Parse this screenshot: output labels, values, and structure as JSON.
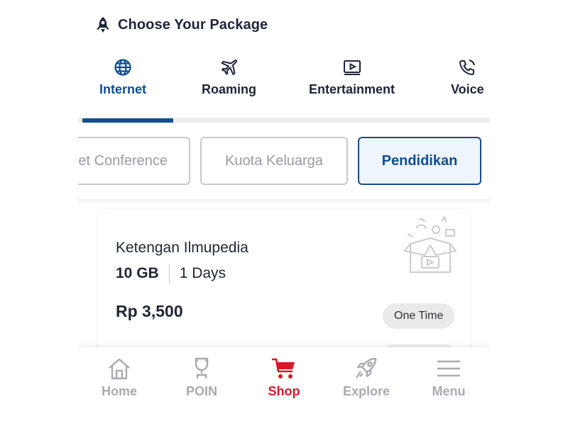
{
  "header": {
    "title": "Choose Your Package",
    "icon": "rocket-icon"
  },
  "tabs": [
    {
      "label": "Internet",
      "icon": "globe-icon",
      "active": true
    },
    {
      "label": "Roaming",
      "icon": "airplane-icon",
      "active": false
    },
    {
      "label": "Entertainment",
      "icon": "play-icon",
      "active": false
    },
    {
      "label": "Voice",
      "icon": "phone-icon",
      "active": false
    }
  ],
  "chips": [
    {
      "label": "Internet Conference",
      "active": false
    },
    {
      "label": "Kuota Keluarga",
      "active": false
    },
    {
      "label": "Pendidikan",
      "active": true
    }
  ],
  "package": {
    "name": "Ketengan Ilmupedia",
    "quota": "10 GB",
    "duration": "1 Days",
    "price": "Rp 3,500",
    "badge": "One Time"
  },
  "bottom_nav": [
    {
      "label": "Home",
      "icon": "home-icon",
      "active": false
    },
    {
      "label": "POIN",
      "icon": "trophy-icon",
      "active": false
    },
    {
      "label": "Shop",
      "icon": "cart-icon",
      "active": true
    },
    {
      "label": "Explore",
      "icon": "rocket-icon",
      "active": false
    },
    {
      "label": "Menu",
      "icon": "menu-icon",
      "active": false
    }
  ],
  "colors": {
    "accent": "#0f4c97",
    "shop_red": "#d7182a",
    "inactive": "#a9abb0"
  }
}
